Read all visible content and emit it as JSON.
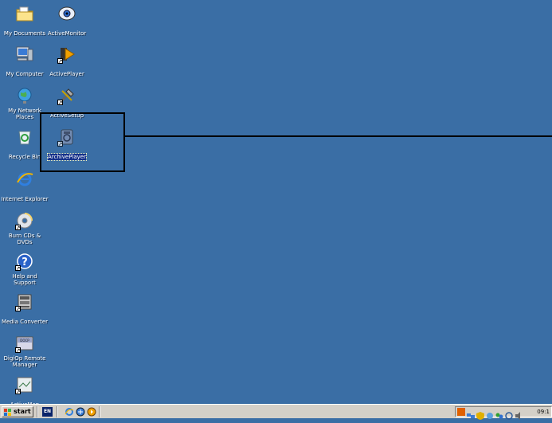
{
  "desktop": {
    "icons": [
      {
        "label": "My Documents"
      },
      {
        "label": "ActiveMonitor"
      },
      {
        "label": "My Computer"
      },
      {
        "label": "ActivePlayer"
      },
      {
        "label": "My Network Places"
      },
      {
        "label": "ActiveSetup"
      },
      {
        "label": "Recycle Bin"
      },
      {
        "label": "ArchivePlayer"
      },
      {
        "label": "Internet Explorer"
      },
      {
        "label": "Burn CDs & DVDs"
      },
      {
        "label": "Help and Support"
      },
      {
        "label": "Media Converter"
      },
      {
        "label": "DigiOp Remote Manager"
      },
      {
        "label": "ActiveMap"
      }
    ],
    "background_color": "#3a6ea5",
    "selected_icon": "ArchivePlayer"
  },
  "taskbar": {
    "start_label": "start",
    "language": "EN",
    "clock": "09:1",
    "quick_launch": [
      "internet-explorer-icon",
      "media-icon",
      "player-icon"
    ],
    "tray_icons": [
      "tray-app-icon",
      "network-icon",
      "shield-icon",
      "app-icon",
      "messenger-icon",
      "sync-icon",
      "speaker-icon"
    ]
  }
}
